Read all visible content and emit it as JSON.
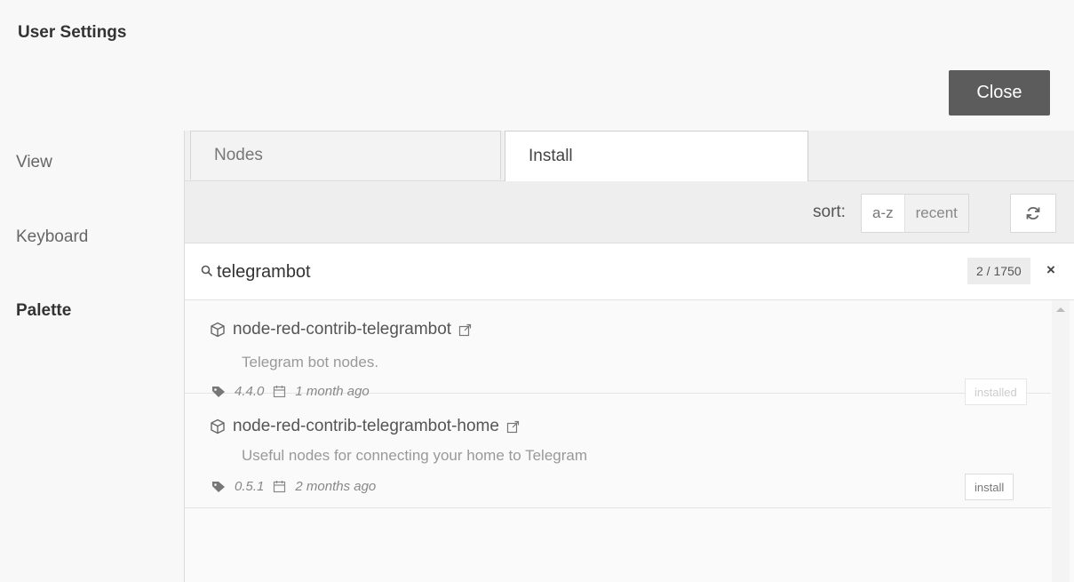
{
  "window": {
    "title": "User Settings",
    "close_label": "Close"
  },
  "nav": {
    "items": [
      {
        "label": "View"
      },
      {
        "label": "Keyboard"
      },
      {
        "label": "Palette"
      }
    ],
    "active": "Palette"
  },
  "tabs": [
    {
      "label": "Nodes"
    },
    {
      "label": "Install"
    }
  ],
  "toolbar": {
    "sort_label": "sort:",
    "sort_options": [
      "a-z",
      "recent"
    ],
    "selected_sort": "a-z",
    "refresh_icon": "refresh-icon"
  },
  "search": {
    "value": "telegrambot",
    "count": "2 / 1750",
    "clear_label": "×"
  },
  "results": [
    {
      "name": "node-red-contrib-telegrambot",
      "description": "Telegram bot nodes.",
      "version": "4.4.0",
      "updated": "1 month ago",
      "action": "installed"
    },
    {
      "name": "node-red-contrib-telegrambot-home",
      "description": "Useful nodes for connecting your home to Telegram",
      "version": "0.5.1",
      "updated": "2 months ago",
      "action": "install"
    }
  ],
  "colors": {
    "close_button_bg": "#5c5c5c",
    "panel_bg": "#fdfdfd",
    "toolbar_bg": "#eeeeee"
  }
}
